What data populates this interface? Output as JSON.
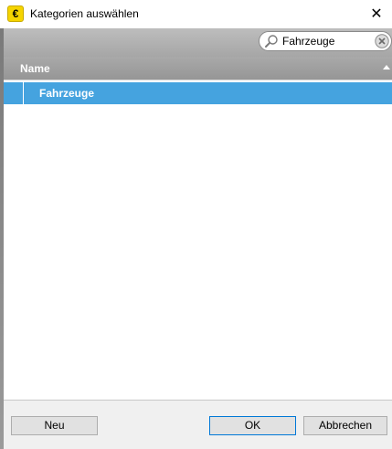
{
  "window": {
    "title": "Kategorien auswählen",
    "app_icon_glyph": "€",
    "close_glyph": "✕"
  },
  "search": {
    "value": "Fahrzeuge",
    "icon": "search-icon",
    "clear_icon": "clear-icon"
  },
  "list": {
    "columns": [
      "Name"
    ],
    "rows": [
      {
        "label": "Fahrzeuge",
        "selected": true
      }
    ]
  },
  "buttons": {
    "new_label": "Neu",
    "ok_label": "OK",
    "cancel_label": "Abbrechen"
  },
  "colors": {
    "selection": "#45a3df",
    "header": "#a0a0a0",
    "app_icon": "#f5d400"
  }
}
